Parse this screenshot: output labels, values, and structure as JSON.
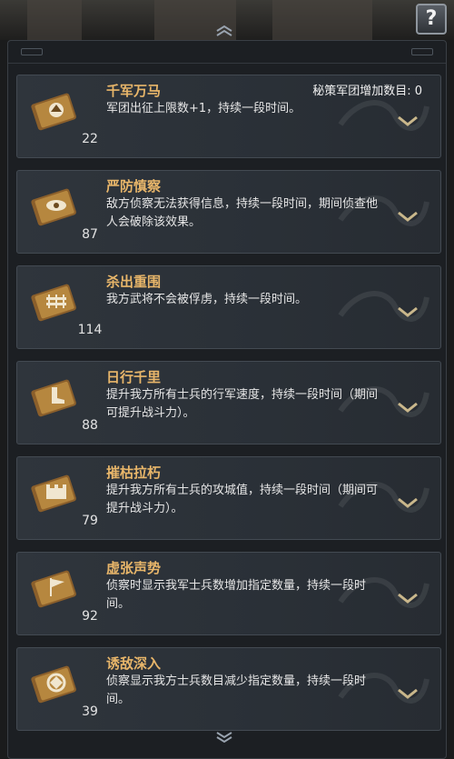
{
  "header": {
    "help_label": "?"
  },
  "limit_label": "秘策军团增加数目: 0",
  "items": [
    {
      "title": "千军万马",
      "desc": "军团出征上限数+1，持续一段时间。",
      "count": "22",
      "icon": "helmet-icon"
    },
    {
      "title": "严防慎察",
      "desc": "敌方侦察无法获得信息，持续一段时间，期间侦查他人会破除该效果。",
      "count": "87",
      "icon": "eye-icon"
    },
    {
      "title": "杀出重围",
      "desc": "我方武将不会被俘虏，持续一段时间。",
      "count": "114",
      "icon": "fence-icon"
    },
    {
      "title": "日行千里",
      "desc": "提升我方所有士兵的行军速度，持续一段时间（期间可提升战斗力）。",
      "count": "88",
      "icon": "boot-icon"
    },
    {
      "title": "摧枯拉朽",
      "desc": "提升我方所有士兵的攻城值，持续一段时间（期间可提升战斗力）。",
      "count": "79",
      "icon": "wall-icon"
    },
    {
      "title": "虚张声势",
      "desc": "侦察时显示我军士兵数增加指定数量，持续一段时间。",
      "count": "92",
      "icon": "banner-icon"
    },
    {
      "title": "诱敌深入",
      "desc": "侦察显示我方士兵数目减少指定数量，持续一段时间。",
      "count": "39",
      "icon": "trap-icon"
    }
  ],
  "colors": {
    "title": "#e8b66a",
    "text": "#e6e6e6",
    "scroll": "#a67a3b"
  }
}
